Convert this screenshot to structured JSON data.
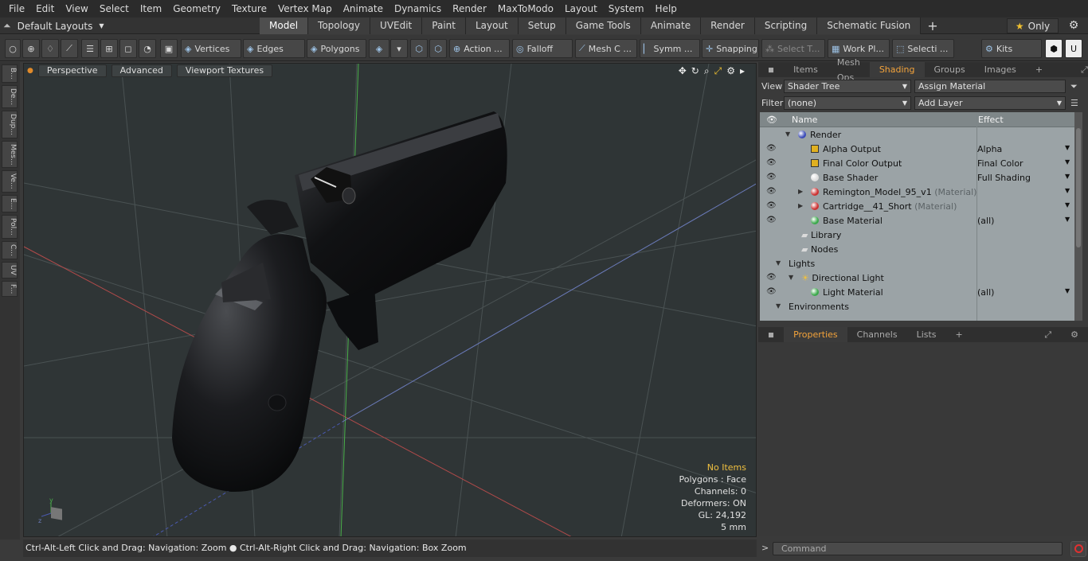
{
  "menu": [
    "File",
    "Edit",
    "View",
    "Select",
    "Item",
    "Geometry",
    "Texture",
    "Vertex Map",
    "Animate",
    "Dynamics",
    "Render",
    "MaxToModo",
    "Layout",
    "System",
    "Help"
  ],
  "layout_dropdown": "Default Layouts",
  "tabs": [
    "Model",
    "Topology",
    "UVEdit",
    "Paint",
    "Layout",
    "Setup",
    "Game Tools",
    "Animate",
    "Render",
    "Scripting",
    "Schematic Fusion"
  ],
  "only_label": "Only",
  "toolbar": {
    "vertices": "Vertices",
    "edges": "Edges",
    "polygons": "Polygons",
    "action": "Action ...",
    "falloff": "Falloff",
    "mesh": "Mesh C ...",
    "symm": "Symm ...",
    "snapping": "Snapping",
    "select_t": "Select T...",
    "work_pl": "Work Pl...",
    "selecti": "Selecti ...",
    "kits": "Kits"
  },
  "left_strip": [
    "B...",
    "De...",
    "Dup...",
    "Mes...",
    "Ve...",
    "E...",
    "Pol...",
    "C...",
    "UV",
    "F..."
  ],
  "viewport": {
    "perspective": "Perspective",
    "advanced": "Advanced",
    "viewport_textures": "Viewport Textures",
    "info": {
      "items": "No Items",
      "polygons": "Polygons : Face",
      "channels": "Channels: 0",
      "deformers": "Deformers: ON",
      "gl": "GL: 24,192",
      "unit": "5 mm"
    }
  },
  "status": "Ctrl-Alt-Left Click and Drag: Navigation: Zoom ● Ctrl-Alt-Right Click and Drag: Navigation: Box Zoom",
  "panel_tabs_top": [
    "Items",
    "Mesh Ops",
    "Shading",
    "Groups",
    "Images"
  ],
  "view_label": "View",
  "view_value": "Shader Tree",
  "assign_material": "Assign Material",
  "filter_label": "Filter",
  "filter_value": "(none)",
  "add_layer": "Add Layer",
  "tree_headers": {
    "name": "Name",
    "effect": "Effect"
  },
  "tree": [
    {
      "name": "Render",
      "sub": "",
      "effect": "",
      "icon": "render"
    },
    {
      "name": "Alpha Output",
      "sub": "",
      "effect": "Alpha",
      "icon": "output"
    },
    {
      "name": "Final Color Output",
      "sub": "",
      "effect": "Final Color",
      "icon": "output"
    },
    {
      "name": "Base Shader",
      "sub": "",
      "effect": "Full Shading",
      "icon": "shader"
    },
    {
      "name": "Remington_Model_95_v1",
      "sub": "(Material)",
      "effect": "",
      "icon": "mask"
    },
    {
      "name": "Cartridge__41_Short",
      "sub": "(Material)",
      "effect": "",
      "icon": "mask"
    },
    {
      "name": "Base Material",
      "sub": "",
      "effect": "(all)",
      "icon": "material"
    },
    {
      "name": "Library",
      "sub": "",
      "effect": "",
      "icon": "folder"
    },
    {
      "name": "Nodes",
      "sub": "",
      "effect": "",
      "icon": "folder"
    },
    {
      "name": "Lights",
      "sub": "",
      "effect": "",
      "icon": "group"
    },
    {
      "name": "Directional Light",
      "sub": "",
      "effect": "",
      "icon": "light"
    },
    {
      "name": "Light Material",
      "sub": "",
      "effect": "(all)",
      "icon": "material"
    },
    {
      "name": "Environments",
      "sub": "",
      "effect": "",
      "icon": "group"
    }
  ],
  "panel_tabs_bottom": [
    "Properties",
    "Channels",
    "Lists"
  ],
  "command_placeholder": "Command",
  "colors": {
    "accent": "#f3a33b",
    "viewport_bg": "#2f3536",
    "tree_bg": "#9ba3a6"
  }
}
